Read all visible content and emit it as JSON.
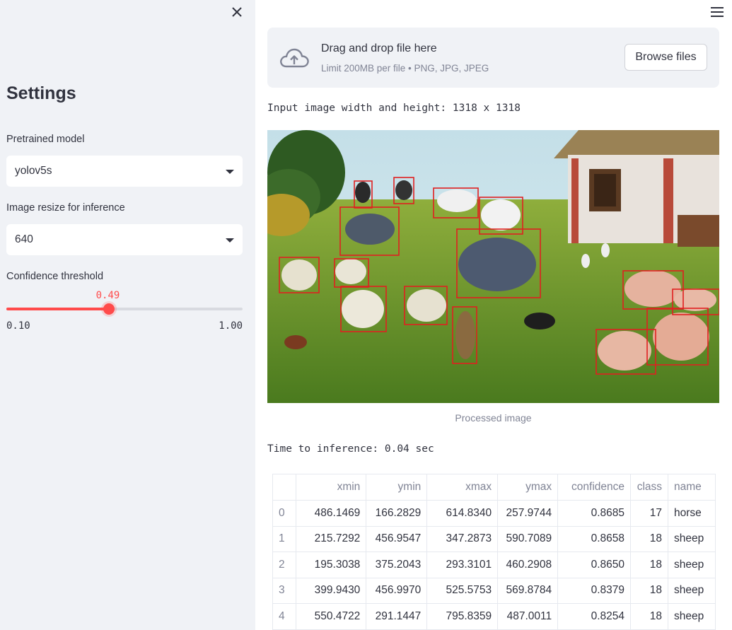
{
  "sidebar": {
    "close_icon": "close-icon",
    "title": "Settings",
    "model": {
      "label": "Pretrained model",
      "value": "yolov5s"
    },
    "resize": {
      "label": "Image resize for inference",
      "value": "640"
    },
    "confidence": {
      "label": "Confidence threshold",
      "value": "0.49",
      "min": "0.10",
      "max": "1.00",
      "fraction": 0.433
    }
  },
  "main": {
    "menu_icon": "hamburger-menu-icon",
    "uploader": {
      "icon": "cloud-upload-icon",
      "title": "Drag and drop file here",
      "subtitle": "Limit 200MB per file • PNG, JPG, JPEG",
      "button": "Browse files"
    },
    "image_info": "Input image width and height: 1318 x 1318",
    "caption": "Processed image",
    "inference_time": "Time to inference: 0.04 sec",
    "table": {
      "columns": [
        "",
        "xmin",
        "ymin",
        "xmax",
        "ymax",
        "confidence",
        "class",
        "name"
      ],
      "rows": [
        [
          "0",
          "486.1469",
          "166.2829",
          "614.8340",
          "257.9744",
          "0.8685",
          "17",
          "horse"
        ],
        [
          "1",
          "215.7292",
          "456.9547",
          "347.2873",
          "590.7089",
          "0.8658",
          "18",
          "sheep"
        ],
        [
          "2",
          "195.3038",
          "375.2043",
          "293.3101",
          "460.2908",
          "0.8650",
          "18",
          "sheep"
        ],
        [
          "3",
          "399.9430",
          "456.9970",
          "525.5753",
          "569.8784",
          "0.8379",
          "18",
          "sheep"
        ],
        [
          "4",
          "550.4722",
          "291.1447",
          "795.8359",
          "487.0011",
          "0.8254",
          "18",
          "sheep"
        ],
        [
          "",
          "",
          "",
          "",
          "",
          "",
          "",
          ""
        ]
      ]
    }
  },
  "colors": {
    "accent": "#ff4b4b",
    "sidebar_bg": "#f0f2f6",
    "box": "#e02020"
  }
}
